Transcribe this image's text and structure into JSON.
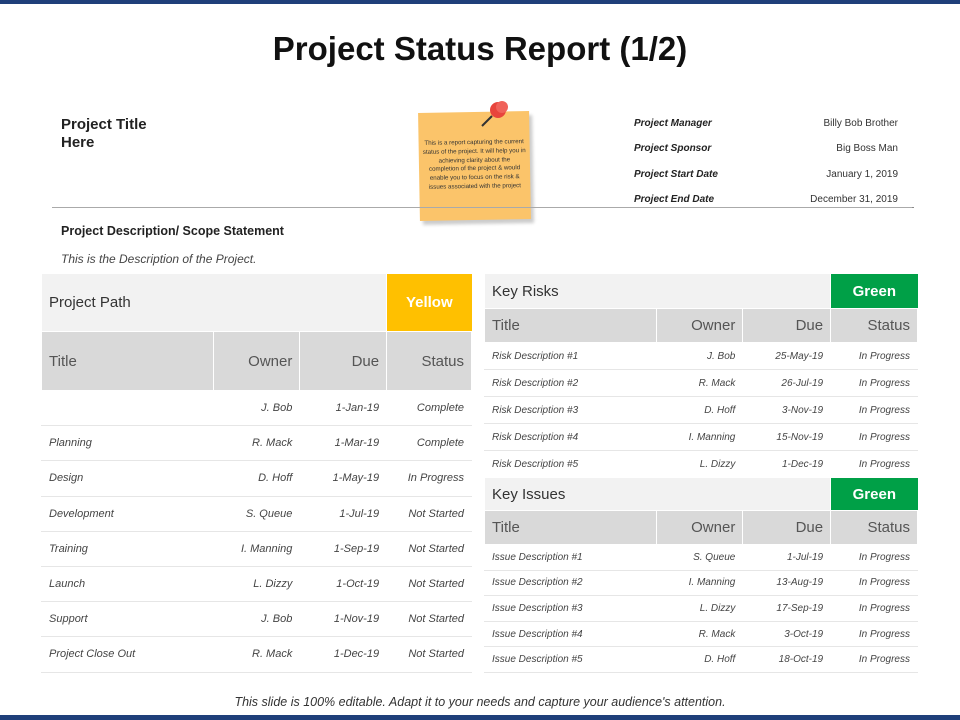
{
  "title": "Project Status Report (1/2)",
  "project_title": "Project Title Here",
  "note": "This is a report capturing the current status of the project. It will help you in achieving clarity about the completion of the project & would enable you to focus on the risk & issues associated with the project",
  "meta": [
    {
      "label": "Project Manager",
      "value": "Billy Bob Brother"
    },
    {
      "label": "Project Sponsor",
      "value": "Big Boss Man"
    },
    {
      "label": "Project Start Date",
      "value": "January 1, 2019"
    },
    {
      "label": "Project End Date",
      "value": "December  31, 2019"
    }
  ],
  "description_heading": "Project Description/ Scope Statement",
  "description": "This is the Description of the Project.",
  "columns": [
    "Title",
    "Owner",
    "Due",
    "Status"
  ],
  "project_path": {
    "heading": "Project Path",
    "status": "Yellow",
    "status_color": "#ffc000",
    "rows": [
      [
        "",
        "J. Bob",
        "1-Jan-19",
        "Complete"
      ],
      [
        "Planning",
        "R. Mack",
        "1-Mar-19",
        "Complete"
      ],
      [
        "Design",
        "D. Hoff",
        "1-May-19",
        "In Progress"
      ],
      [
        "Development",
        "S. Queue",
        "1-Jul-19",
        "Not Started"
      ],
      [
        "Training",
        "I. Manning",
        "1-Sep-19",
        "Not Started"
      ],
      [
        "Launch",
        "L. Dizzy",
        "1-Oct-19",
        "Not Started"
      ],
      [
        "Support",
        "J. Bob",
        "1-Nov-19",
        "Not Started"
      ],
      [
        "Project Close Out",
        "R. Mack",
        "1-Dec-19",
        "Not Started"
      ]
    ]
  },
  "key_risks": {
    "heading": "Key Risks",
    "status": "Green",
    "status_color": "#00a047",
    "rows": [
      [
        "Risk Description #1",
        "J. Bob",
        "25-May-19",
        "In Progress"
      ],
      [
        "Risk Description #2",
        "R. Mack",
        "26-Jul-19",
        "In Progress"
      ],
      [
        "Risk Description #3",
        "D. Hoff",
        "3-Nov-19",
        "In Progress"
      ],
      [
        "Risk Description #4",
        "I. Manning",
        "15-Nov-19",
        "In Progress"
      ],
      [
        "Risk Description #5",
        "L. Dizzy",
        "1-Dec-19",
        "In Progress"
      ]
    ]
  },
  "key_issues": {
    "heading": "Key Issues",
    "status": "Green",
    "status_color": "#00a047",
    "rows": [
      [
        "Issue Description #1",
        "S. Queue",
        "1-Jul-19",
        "In Progress"
      ],
      [
        "Issue Description #2",
        "I. Manning",
        "13-Aug-19",
        "In Progress"
      ],
      [
        "Issue Description #3",
        "L. Dizzy",
        "17-Sep-19",
        "In Progress"
      ],
      [
        "Issue Description #4",
        "R. Mack",
        "3-Oct-19",
        "In Progress"
      ],
      [
        "Issue Description #5",
        "D. Hoff",
        "18-Oct-19",
        "In Progress"
      ]
    ]
  },
  "footer": "This slide is 100% editable. Adapt it to your needs and capture your audience's  attention."
}
